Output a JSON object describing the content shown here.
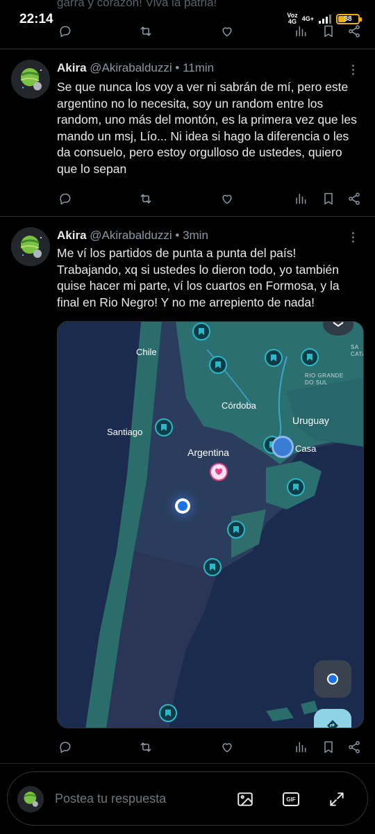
{
  "status": {
    "time": "22:14",
    "net_top": "Voz",
    "net_bottom": "4G",
    "net2": "4G+",
    "battery": "38"
  },
  "prev_tweet": {
    "text_fragment": "garra y corazon! Viva la patria!"
  },
  "tweets": [
    {
      "name": "Akira",
      "handle": "@Akirabalduzzi",
      "separator": "•",
      "time": "11min",
      "text": "Se que nunca los voy a ver ni sabrán de mí, pero este argentino no lo necesita, soy un random entre los random, uno más del montón, es la primera vez que les mando un msj, Lío... Ni idea si hago la diferencia o les da consuelo, pero estoy orgulloso de ustedes, quiero que lo sepan"
    },
    {
      "name": "Akira",
      "handle": "@Akirabalduzzi",
      "separator": "•",
      "time": "3min",
      "text": "Me ví los partidos de punta a punta del país! Trabajando, xq si ustedes lo dieron todo, yo también quise hacer mi parte, ví los cuartos en Formosa, y la final en Rio Negro! Y no me arrepiento de nada!"
    }
  ],
  "map": {
    "labels": {
      "chile": "Chile",
      "rio_grande_1": "RIO GRANDE",
      "rio_grande_2": "DO SUL",
      "sc_1": "SA",
      "sc_2": "CATA",
      "cordoba": "Córdoba",
      "uruguay": "Uruguay",
      "santiago": "Santiago",
      "casa": "Casa",
      "argentina": "Argentina"
    }
  },
  "reply": {
    "placeholder": "Postea tu respuesta",
    "gif_label": "GIF"
  },
  "icons": {
    "reply": "reply-icon",
    "retweet": "retweet-icon",
    "like": "heart-icon",
    "views": "views-icon",
    "bookmark": "bookmark-icon",
    "share": "share-icon",
    "image": "image-icon",
    "gif": "gif-icon",
    "expand": "expand-icon"
  },
  "colors": {
    "background": "#000000",
    "text": "#e7e9ea",
    "muted": "#8b98a5",
    "map_water": "#1a2a4d",
    "map_land": "#2a6b6e",
    "pin_accent": "#2bb8c9",
    "heart_pin": "#e0438b",
    "battery": "#f0b400"
  }
}
